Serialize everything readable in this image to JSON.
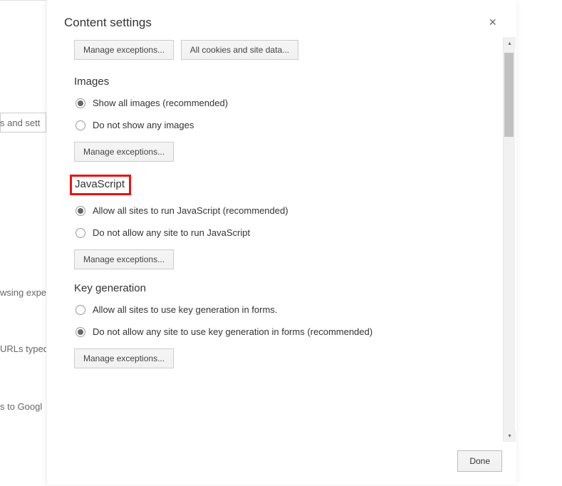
{
  "background": {
    "search_placeholder": "s and sett",
    "text2": "wsing expe",
    "text3": "URLs typed",
    "text4": "s to Googl"
  },
  "dialog": {
    "title": "Content settings",
    "close": "×",
    "top_buttons": {
      "manage": "Manage exceptions...",
      "all_cookies": "All cookies and site data..."
    },
    "sections": {
      "images": {
        "title": "Images",
        "opt1": "Show all images (recommended)",
        "opt2": "Do not show any images",
        "manage": "Manage exceptions..."
      },
      "javascript": {
        "title": "JavaScript",
        "opt1": "Allow all sites to run JavaScript (recommended)",
        "opt2": "Do not allow any site to run JavaScript",
        "manage": "Manage exceptions..."
      },
      "keygen": {
        "title": "Key generation",
        "opt1": "Allow all sites to use key generation in forms.",
        "opt2": "Do not allow any site to use key generation in forms (recommended)",
        "manage": "Manage exceptions..."
      }
    },
    "done": "Done"
  }
}
